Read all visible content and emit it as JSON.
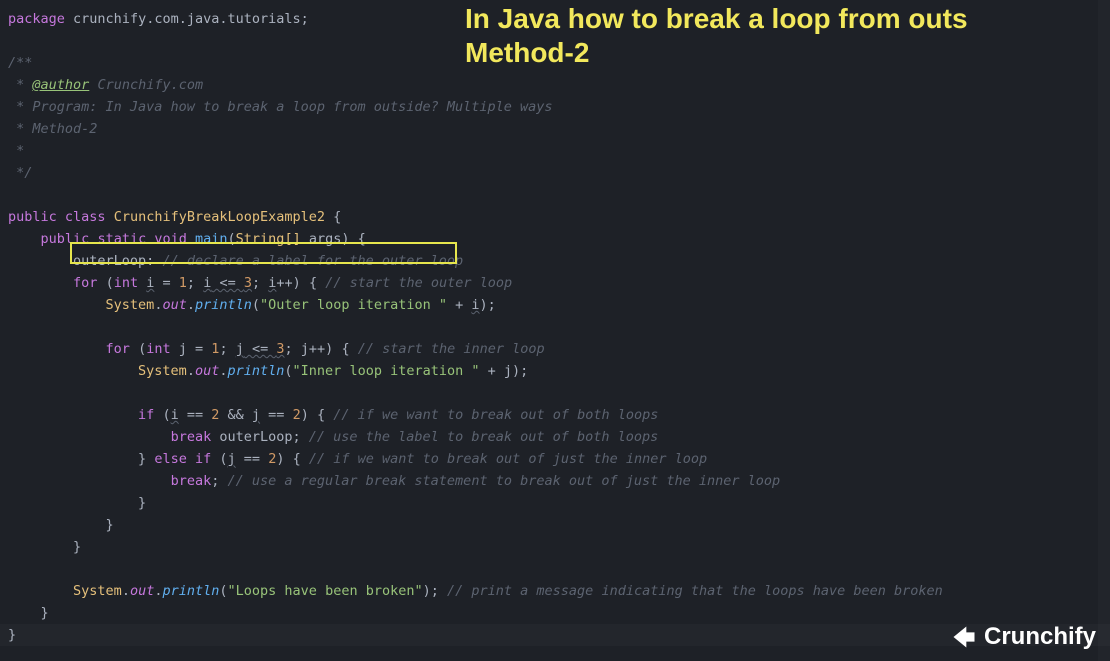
{
  "overlay": {
    "line1": "In Java how to break a loop from outs",
    "line2": "Method-2"
  },
  "code": {
    "package_kw": "package",
    "package_name": "crunchify.com.java.tutorials",
    "semicolon": ";",
    "doc_open": "/**",
    "doc_author_tag": "@author",
    "doc_author_val": "Crunchify.com",
    "doc_prog": " * Program: In Java how to break a loop from outside? Multiple ways",
    "doc_method": " * Method-2",
    "doc_star": " *",
    "doc_close": " */",
    "public": "public",
    "class": "class",
    "class_name": "CrunchifyBreakLoopExample2",
    "static": "static",
    "void": "void",
    "main": "main",
    "main_args_type": "String[]",
    "main_args_name": "args",
    "label_outer": "outerLoop:",
    "c_label": "// declare a label for the outer loop",
    "for": "for",
    "int": "int",
    "i": "i",
    "j": "j",
    "eq1": "= ",
    "one": "1",
    "three": "3",
    "le": " <= ",
    "pp": "++",
    "c_outer": "// start the outer loop",
    "sys": "System",
    "dot": ".",
    "out": "out",
    "println": "println",
    "s_outer": "\"Outer loop iteration \"",
    "plus": " + ",
    "c_inner": "// start the inner loop",
    "s_inner": "\"Inner loop iteration \"",
    "if": "if",
    "eqeq": " == ",
    "two": "2",
    "and": " && ",
    "c_ifboth": "// if we want to break out of both loops",
    "break": "break",
    "c_breakboth": "// use the label to break out of both loops",
    "else": "else",
    "c_ifinner": "// if we want to break out of just the inner loop",
    "c_breakinner": "// use a regular break statement to break out of just the inner loop",
    "s_done": "\"Loops have been broken\"",
    "c_done": "// print a message indicating that the loops have been broken"
  },
  "logo": {
    "text": "Crunchify"
  }
}
